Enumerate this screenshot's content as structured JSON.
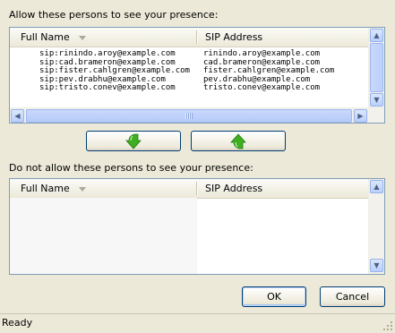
{
  "allow_section": {
    "label": "Allow these persons to see your presence:",
    "columns": {
      "name": "Full Name",
      "sip": "SIP Address"
    },
    "rows": [
      {
        "name": "sip:rinindo.aroy@example.com",
        "sip": "rinindo.aroy@example.com"
      },
      {
        "name": "sip:cad.brameron@example.com",
        "sip": "cad.brameron@example.com"
      },
      {
        "name": "sip:fister.cahlgren@example.com",
        "sip": "fister.cahlgren@example.com"
      },
      {
        "name": "sip:pev.drabhu@example.com",
        "sip": "pev.drabhu@example.com"
      },
      {
        "name": "sip:tristo.conev@example.com",
        "sip": "tristo.conev@example.com"
      }
    ]
  },
  "move_buttons": {
    "down": {
      "icon": "green-arrow-down-icon"
    },
    "up": {
      "icon": "green-arrow-up-icon"
    }
  },
  "deny_section": {
    "label": "Do not allow these persons to see your presence:",
    "columns": {
      "name": "Full Name",
      "sip": "SIP Address"
    },
    "rows": []
  },
  "dialog_buttons": {
    "ok": "OK",
    "cancel": "Cancel"
  },
  "status": {
    "text": "Ready"
  },
  "colors": {
    "accent_green": "#3fae1f",
    "background": "#ece9d8",
    "border": "#7f9db9"
  }
}
